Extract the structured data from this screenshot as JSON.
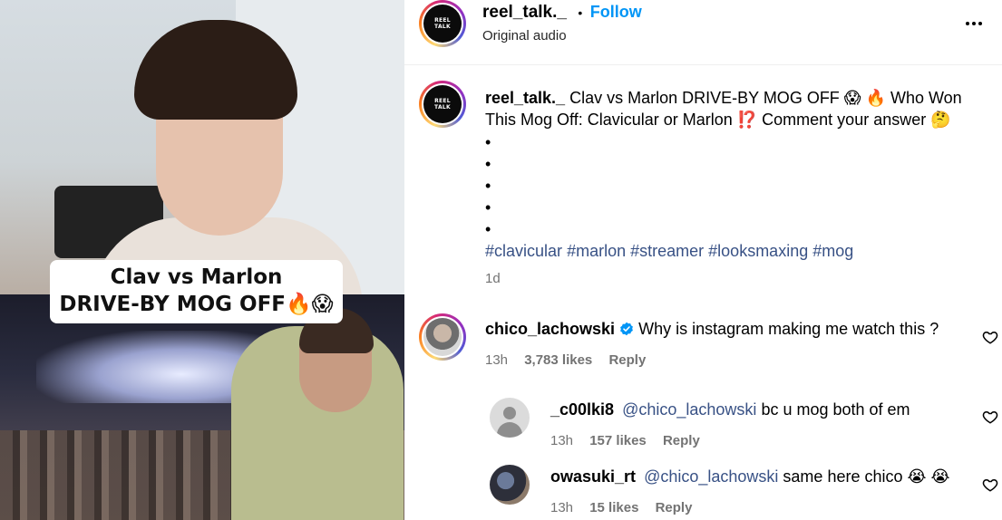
{
  "video": {
    "caption_line1": "Clav vs Marlon",
    "caption_line2": "DRIVE-BY MOG OFF🔥😱"
  },
  "header": {
    "avatar_text_line1": "REEL",
    "avatar_text_line2": "TALK",
    "username": "reel_talk._",
    "separator": "•",
    "follow_label": "Follow",
    "audio": "Original audio"
  },
  "post": {
    "username": "reel_talk._",
    "caption": "Clav vs Marlon DRIVE-BY MOG OFF 😱 🔥  Who Won This Mog Off: Clavicular or Marlon ⁉️  Comment your answer 🤔",
    "bullets": [
      "•",
      "•",
      "•",
      "•",
      "•"
    ],
    "hashtags": [
      "#clavicular",
      "#marlon",
      "#streamer",
      "#looksmaxing",
      "#mog"
    ],
    "time": "1d"
  },
  "comments": [
    {
      "username": "chico_lachowski",
      "verified": true,
      "mention": "",
      "text": "Why is instagram making me watch this ?",
      "time": "13h",
      "likes": "3,783 likes",
      "reply": "Reply"
    },
    {
      "username": "_c00lki8",
      "verified": false,
      "mention": "@chico_lachowski",
      "text": "bc u mog both of em",
      "time": "13h",
      "likes": "157 likes",
      "reply": "Reply"
    },
    {
      "username": "owasuki_rt",
      "verified": false,
      "mention": "@chico_lachowski",
      "text": "same here chico 😭 😭",
      "time": "13h",
      "likes": "15 likes",
      "reply": "Reply"
    }
  ],
  "colors": {
    "follow_blue": "#0095f6",
    "hashtag_blue": "#385185",
    "meta_gray": "#737373",
    "verified_blue": "#0095f6"
  },
  "icons": [
    "more-options-icon",
    "heart-icon",
    "verified-badge-icon",
    "default-avatar-icon"
  ]
}
